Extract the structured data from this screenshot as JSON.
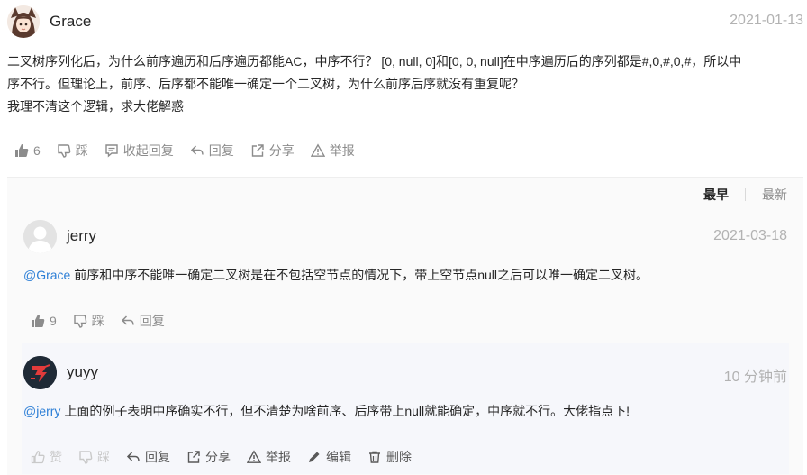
{
  "post": {
    "author": "Grace",
    "date": "2021-01-13",
    "line1": "二叉树序列化后，为什么前序遍历和后序遍历都能AC，中序不行？ [0, null, 0]和[0, 0, null]在中序遍历后的序列都是#,0,#,0,#，所以中",
    "line2": "序不行。但理论上，前序、后序都不能唯一确定一个二叉树，为什么前序后序就没有重复呢？",
    "line3": "我理不清这个逻辑，求大佬解惑",
    "actions": {
      "like_count": "6",
      "dislike": "踩",
      "collapse": "收起回复",
      "reply": "回复",
      "share": "分享",
      "report": "举报"
    }
  },
  "sort": {
    "earliest": "最早",
    "latest": "最新"
  },
  "reply1": {
    "author": "jerry",
    "date": "2021-03-18",
    "mention": "@Grace",
    "text": " 前序和中序不能唯一确定二叉树是在不包括空节点的情况下，带上空节点null之后可以唯一确定二叉树。",
    "actions": {
      "like_count": "9",
      "dislike": "踩",
      "reply": "回复"
    }
  },
  "reply2": {
    "author": "yuyy",
    "date": "10 分钟前",
    "mention": "@jerry",
    "text": " 上面的例子表明中序确实不行，但不清楚为啥前序、后序带上null就能确定，中序就不行。大佬指点下!",
    "actions": {
      "like": "赞",
      "dislike": "踩",
      "reply": "回复",
      "share": "分享",
      "report": "举报",
      "edit": "编辑",
      "delete": "删除"
    }
  }
}
